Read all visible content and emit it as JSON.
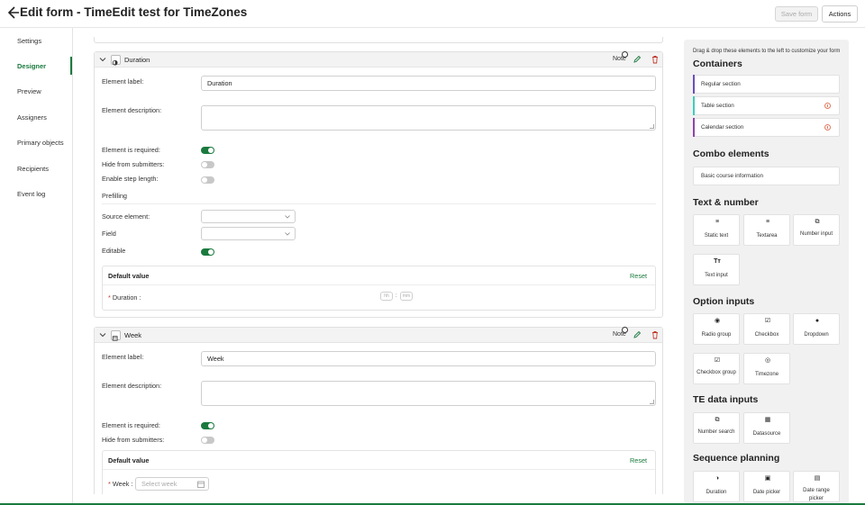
{
  "header": {
    "title": "Edit form - TimeEdit test for TimeZones",
    "save_label": "Save form",
    "actions_label": "Actions"
  },
  "nav": {
    "items": [
      {
        "label": "Settings"
      },
      {
        "label": "Designer"
      },
      {
        "label": "Preview"
      },
      {
        "label": "Assigners"
      },
      {
        "label": "Primary objects"
      },
      {
        "label": "Recipients"
      },
      {
        "label": "Event log"
      }
    ],
    "active": "Designer"
  },
  "duration_element": {
    "name": "Duration",
    "note_label": "Note",
    "element_label": "Element label:",
    "element_label_value": "Duration",
    "element_description": "Element description:",
    "required_label": "Element is required:",
    "required": true,
    "hide_label": "Hide from submitters:",
    "hide": false,
    "step_label": "Enable step length:",
    "step": false,
    "prefilling_label": "Prefilling",
    "source_label": "Source element:",
    "field_label": "Field",
    "editable_label": "Editable",
    "editable": true,
    "default_value_title": "Default value",
    "reset_label": "Reset",
    "duration_field_label": "Duration :",
    "hh_placeholder": "hh",
    "mm_placeholder": "mm",
    "colon": ":"
  },
  "week_element": {
    "name": "Week",
    "note_label": "Note",
    "element_label": "Element label:",
    "element_label_value": "Week",
    "element_description": "Element description:",
    "required_label": "Element is required:",
    "required": true,
    "hide_label": "Hide from submitters:",
    "hide": false,
    "default_value_title": "Default value",
    "reset_label": "Reset",
    "week_field_label": "Week :",
    "week_placeholder": "Select week"
  },
  "required_mark": "*",
  "sidebar": {
    "hint": "Drag & drop these elements to the left to customize your form",
    "containers_heading": "Containers",
    "containers": [
      {
        "label": "Regular section",
        "stripe": "#6b4fbb"
      },
      {
        "label": "Table section",
        "stripe": "#3ccfb8"
      },
      {
        "label": "Calendar section",
        "stripe": "#8e44ad"
      }
    ],
    "combo_heading": "Combo elements",
    "combo": [
      {
        "label": "Basic course information"
      }
    ],
    "text_heading": "Text & number",
    "text_tiles": [
      {
        "label": "Static text",
        "icon": "static-text-icon",
        "glyph": "≡"
      },
      {
        "label": "Textarea",
        "icon": "textarea-icon",
        "glyph": "≡"
      },
      {
        "label": "Number input",
        "icon": "number-input-icon",
        "glyph": "⧉"
      },
      {
        "label": "Text input",
        "icon": "text-input-icon",
        "glyph": "Tт"
      }
    ],
    "option_heading": "Option inputs",
    "option_tiles": [
      {
        "label": "Radio group",
        "icon": "radio-icon",
        "glyph": "◉"
      },
      {
        "label": "Checkbox",
        "icon": "checkbox-icon",
        "glyph": "☑"
      },
      {
        "label": "Dropdown",
        "icon": "dropdown-icon",
        "glyph": "●"
      },
      {
        "label": "Checkbox group",
        "icon": "checkbox-group-icon",
        "glyph": "☑"
      },
      {
        "label": "Timezone",
        "icon": "globe-icon",
        "glyph": "◎"
      }
    ],
    "te_heading": "TE data inputs",
    "te_tiles": [
      {
        "label": "Number search",
        "icon": "number-search-icon",
        "glyph": "⧉"
      },
      {
        "label": "Datasource",
        "icon": "datasource-icon",
        "glyph": "▦"
      }
    ],
    "seq_heading": "Sequence planning",
    "seq_tiles": [
      {
        "label": "Duration",
        "icon": "duration-icon",
        "glyph": "◑"
      },
      {
        "label": "Date picker",
        "icon": "date-picker-icon",
        "glyph": "▣"
      },
      {
        "label": "Date range picker",
        "icon": "date-range-icon",
        "glyph": "▤"
      }
    ]
  }
}
